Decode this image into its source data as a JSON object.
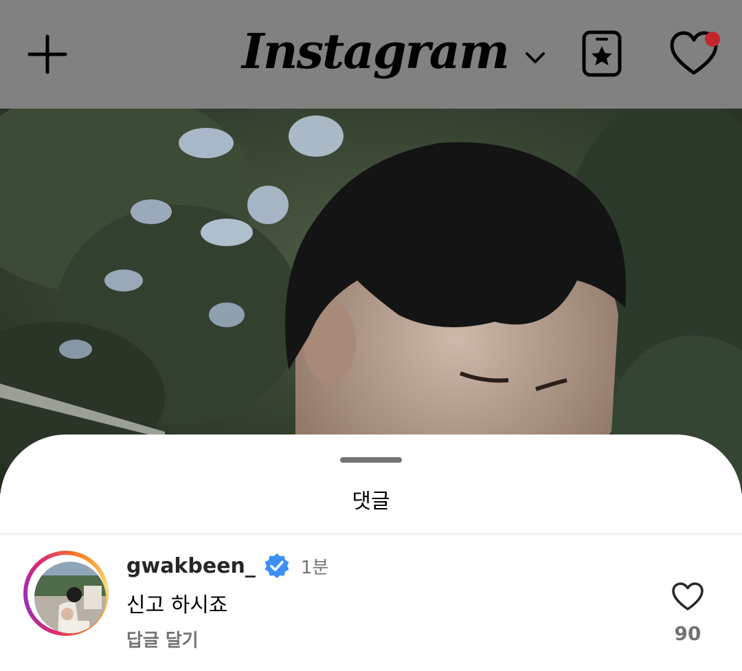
{
  "header": {
    "logo_text": "Instagram",
    "notification_dot_color": "#c4262e"
  },
  "sheet": {
    "title": "댓글"
  },
  "comment": {
    "username": "gwakbeen_",
    "time": "1분",
    "text": "신고 하시죠",
    "reply_label": "답글 달기",
    "like_count": "90",
    "verified_color": "#3d8ef6"
  }
}
